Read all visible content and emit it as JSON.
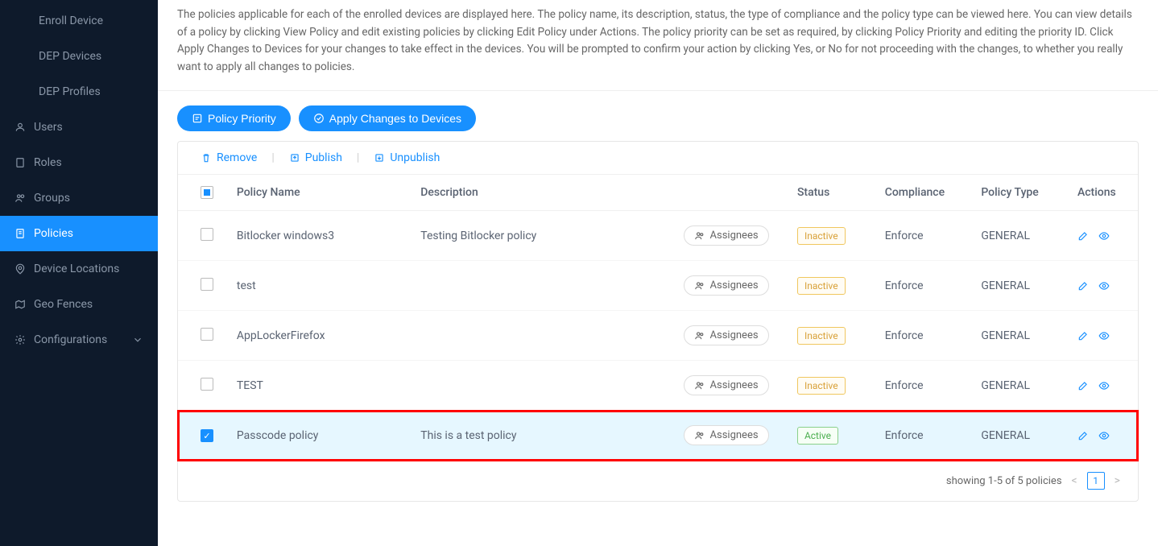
{
  "sidebar": {
    "items": [
      {
        "label": "Enroll Device",
        "icon": "",
        "sub": true,
        "active": false
      },
      {
        "label": "DEP Devices",
        "icon": "",
        "sub": true,
        "active": false
      },
      {
        "label": "DEP Profiles",
        "icon": "",
        "sub": true,
        "active": false
      },
      {
        "label": "Users",
        "icon": "user-icon",
        "sub": false,
        "active": false
      },
      {
        "label": "Roles",
        "icon": "roles-icon",
        "sub": false,
        "active": false
      },
      {
        "label": "Groups",
        "icon": "groups-icon",
        "sub": false,
        "active": false
      },
      {
        "label": "Policies",
        "icon": "policies-icon",
        "sub": false,
        "active": true
      },
      {
        "label": "Device Locations",
        "icon": "location-icon",
        "sub": false,
        "active": false
      },
      {
        "label": "Geo Fences",
        "icon": "geofence-icon",
        "sub": false,
        "active": false
      },
      {
        "label": "Configurations",
        "icon": "settings-icon",
        "sub": false,
        "active": false,
        "expandable": true
      }
    ]
  },
  "description": "The policies applicable for each of the enrolled devices are displayed here. The policy name, its description, status, the type of compliance and the policy type can be viewed here. You can view details of a policy by clicking View Policy and edit existing policies by clicking Edit Policy under Actions. The policy priority can be set as required, by clicking Policy Priority and editing the priority ID. Click Apply Changes to Devices for your changes to take effect in the devices. You will be prompted to confirm your action by clicking Yes, or No for not proceeding with the changes, to whether you really want to apply all changes to policies.",
  "toolbar": {
    "policy_priority": "Policy Priority",
    "apply_changes": "Apply Changes to Devices"
  },
  "table_actions": {
    "remove": "Remove",
    "publish": "Publish",
    "unpublish": "Unpublish"
  },
  "table": {
    "headers": {
      "policy_name": "Policy Name",
      "description": "Description",
      "status": "Status",
      "compliance": "Compliance",
      "policy_type": "Policy Type",
      "actions": "Actions"
    },
    "assignees_label": "Assignees",
    "rows": [
      {
        "checked": false,
        "name": "Bitlocker windows3",
        "description": "Testing Bitlocker policy",
        "status": "Inactive",
        "status_class": "inactive",
        "compliance": "Enforce",
        "type": "GENERAL",
        "selected": false
      },
      {
        "checked": false,
        "name": "test",
        "description": "",
        "status": "Inactive",
        "status_class": "inactive",
        "compliance": "Enforce",
        "type": "GENERAL",
        "selected": false
      },
      {
        "checked": false,
        "name": "AppLockerFirefox",
        "description": "",
        "status": "Inactive",
        "status_class": "inactive",
        "compliance": "Enforce",
        "type": "GENERAL",
        "selected": false
      },
      {
        "checked": false,
        "name": "TEST",
        "description": "",
        "status": "Inactive",
        "status_class": "inactive",
        "compliance": "Enforce",
        "type": "GENERAL",
        "selected": false
      },
      {
        "checked": true,
        "name": "Passcode policy",
        "description": "This is a test policy",
        "status": "Active",
        "status_class": "active",
        "compliance": "Enforce",
        "type": "GENERAL",
        "selected": true,
        "highlighted": true
      }
    ]
  },
  "footer": {
    "text": "showing 1-5 of 5 policies",
    "current_page": "1"
  }
}
